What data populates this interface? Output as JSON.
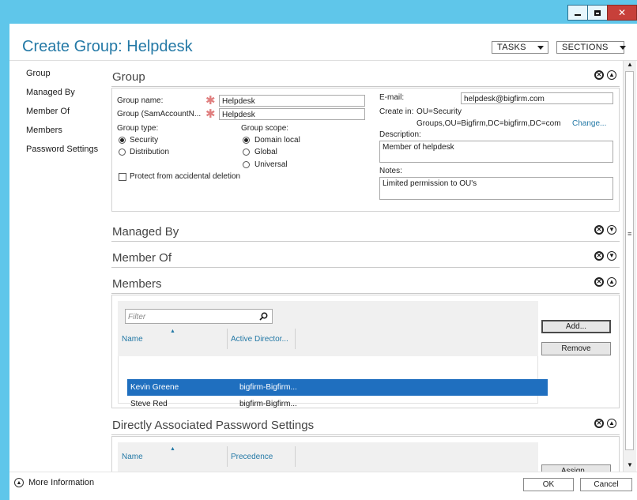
{
  "window": {
    "minimize_icon": "minimize-icon",
    "maximize_icon": "maximize-icon",
    "close_icon": "close-icon"
  },
  "header": {
    "title": "Create Group: Helpdesk",
    "tasks_label": "TASKS",
    "sections_label": "SECTIONS"
  },
  "nav": {
    "items": [
      {
        "label": "Group"
      },
      {
        "label": "Managed By"
      },
      {
        "label": "Member Of"
      },
      {
        "label": "Members"
      },
      {
        "label": "Password Settings"
      }
    ]
  },
  "group": {
    "title": "Group",
    "name_label": "Group name:",
    "name_value": "Helpdesk",
    "sam_label": "Group (SamAccountN...",
    "sam_value": "Helpdesk",
    "type_label": "Group type:",
    "type_options": [
      "Security",
      "Distribution"
    ],
    "type_selected": "Security",
    "scope_label": "Group scope:",
    "scope_options": [
      "Domain local",
      "Global",
      "Universal"
    ],
    "scope_selected": "Domain local",
    "protect_label": "Protect from accidental deletion",
    "email_label": "E-mail:",
    "email_value": "helpdesk@bigfirm.com",
    "create_in_label": "Create in:",
    "create_in_line1": "OU=Security",
    "create_in_line2": "Groups,OU=Bigfirm,DC=bigfirm,DC=com",
    "change_link": "Change...",
    "description_label": "Description:",
    "description_value": "Member of helpdesk",
    "notes_label": "Notes:",
    "notes_value": "Limited permission to OU's"
  },
  "managed_by": {
    "title": "Managed By"
  },
  "member_of": {
    "title": "Member Of"
  },
  "members": {
    "title": "Members",
    "filter_placeholder": "Filter",
    "columns": [
      "Name",
      "Active Director..."
    ],
    "rows": [
      {
        "name": "Kevin Greene",
        "ad": "bigfirm-Bigfirm...",
        "selected": true
      },
      {
        "name": "Steve Red",
        "ad": "bigfirm-Bigfirm...",
        "selected": false
      }
    ],
    "add_label": "Add...",
    "remove_label": "Remove"
  },
  "password_settings": {
    "title": "Directly Associated Password Settings",
    "columns": [
      "Name",
      "Precedence"
    ],
    "assign_label": "Assign..."
  },
  "footer": {
    "more_info": "More Information",
    "ok_label": "OK",
    "cancel_label": "Cancel"
  }
}
